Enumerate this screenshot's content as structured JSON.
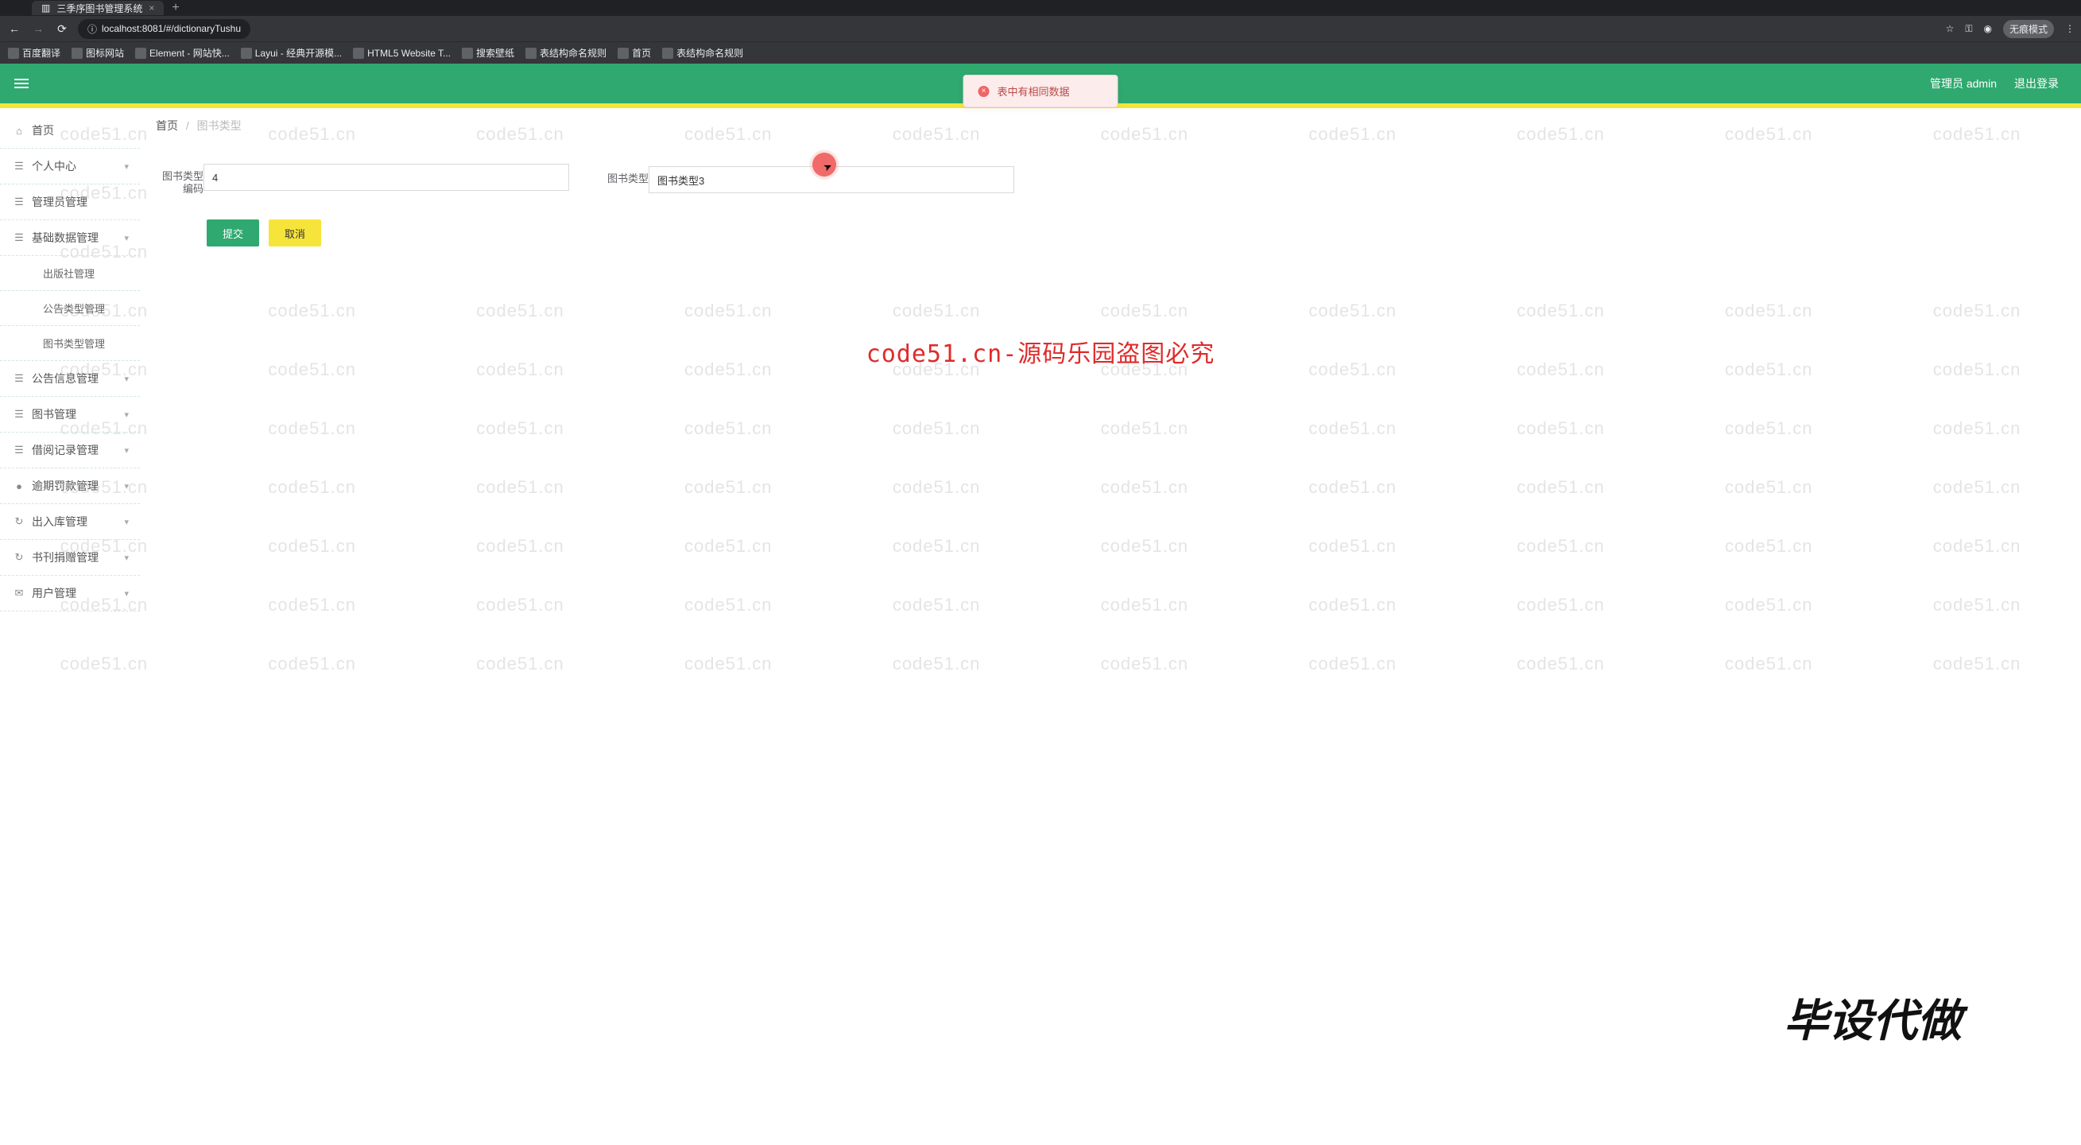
{
  "browser": {
    "tab_title": "三季序图书管理系统",
    "url": "localhost:8081/#/dictionaryTushu",
    "incognito_label": "无痕模式"
  },
  "bookmarks": [
    "百度翻译",
    "图标网站",
    "Element - 网站快...",
    "Layui - 经典开源模...",
    "HTML5 Website T...",
    "搜索壁纸",
    "表结构命名规则",
    "首页",
    "表结构命名规则"
  ],
  "header": {
    "admin_label": "管理员 admin",
    "logout_label": "退出登录"
  },
  "toast": {
    "message": "表中有相同数据"
  },
  "breadcrumb": {
    "home": "首页",
    "current": "图书类型"
  },
  "sidebar": [
    {
      "icon": "⌂",
      "label": "首页",
      "expandable": false
    },
    {
      "icon": "☰",
      "label": "个人中心",
      "expandable": true
    },
    {
      "icon": "☰",
      "label": "管理员管理",
      "expandable": false
    },
    {
      "icon": "☰",
      "label": "基础数据管理",
      "expandable": true
    },
    {
      "icon": "",
      "label": "出版社管理",
      "sub": true
    },
    {
      "icon": "",
      "label": "公告类型管理",
      "sub": true
    },
    {
      "icon": "",
      "label": "图书类型管理",
      "sub": true
    },
    {
      "icon": "☰",
      "label": "公告信息管理",
      "expandable": true
    },
    {
      "icon": "☰",
      "label": "图书管理",
      "expandable": true
    },
    {
      "icon": "☰",
      "label": "借阅记录管理",
      "expandable": true
    },
    {
      "icon": "●",
      "label": "逾期罚款管理",
      "expandable": true
    },
    {
      "icon": "↻",
      "label": "出入库管理",
      "expandable": true
    },
    {
      "icon": "↻",
      "label": "书刊捐赠管理",
      "expandable": true
    },
    {
      "icon": "✉",
      "label": "用户管理",
      "expandable": true
    }
  ],
  "form": {
    "field1_label": "图书类型编码",
    "field1_value": "4",
    "field2_label": "图书类型",
    "field2_value": "图书类型3",
    "submit_label": "提交",
    "cancel_label": "取消"
  },
  "overlays": {
    "watermark_text": "code51.cn",
    "red_text": "code51.cn-源码乐园盗图必究",
    "big_text": "毕设代做"
  }
}
